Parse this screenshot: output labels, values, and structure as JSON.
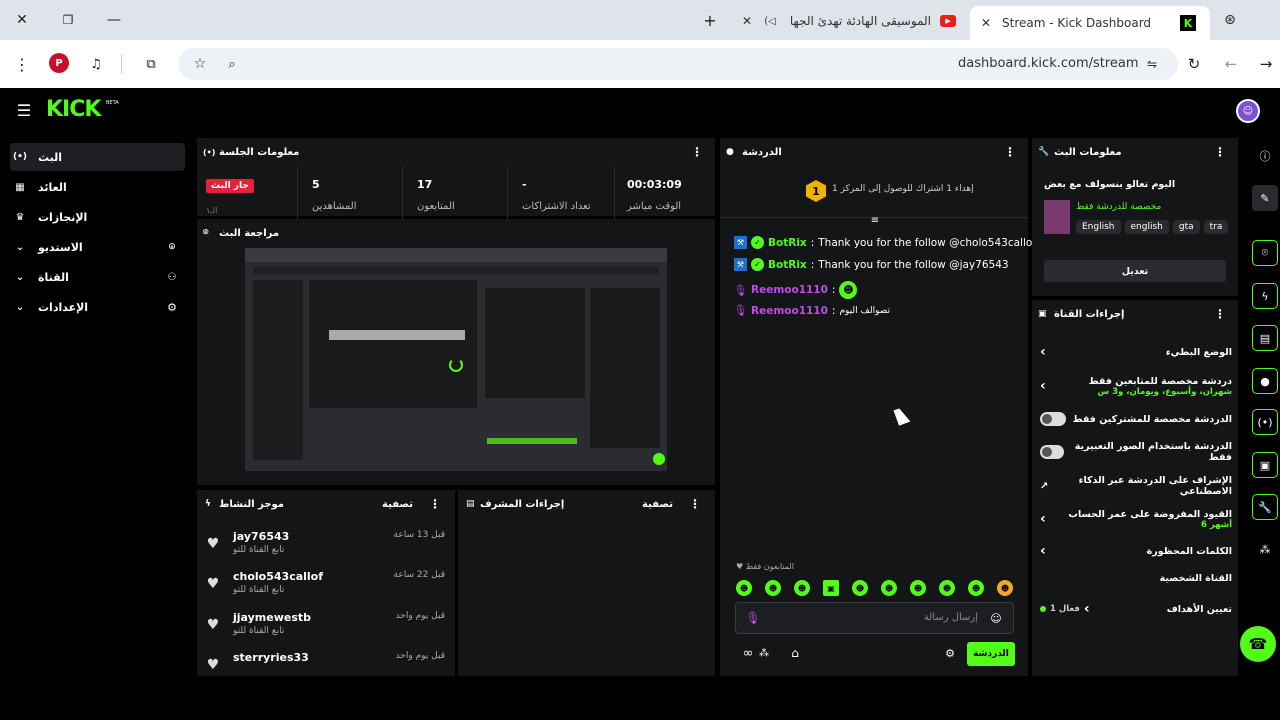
{
  "browser": {
    "tabs": [
      {
        "title": "Stream - Kick Dashboard",
        "active": true
      },
      {
        "title": "الموسيقى الهادئة تهدئ الجها",
        "active": false
      }
    ],
    "url": "dashboard.kick.com/stream",
    "profile_letter": "P"
  },
  "app": {
    "logo": "KICK",
    "logo_badge": "BETA"
  },
  "nav": {
    "items": [
      {
        "label": "البث"
      },
      {
        "label": "العائد"
      },
      {
        "label": "الإنجازات"
      },
      {
        "label": "الاستديو"
      },
      {
        "label": "القناة"
      },
      {
        "label": "الإعدادات"
      }
    ]
  },
  "session": {
    "title": "معلومات الجلسة",
    "live_badge": "جار البث",
    "live_sub": "الـ۱",
    "stats": [
      {
        "value": "5",
        "label": "المشاهدين"
      },
      {
        "value": "17",
        "label": "المتابعون"
      },
      {
        "value": "-",
        "label": "تعداد الاشتراكات"
      },
      {
        "value": "00:03:09",
        "label": "الوقت مباشر"
      }
    ]
  },
  "preview": {
    "title": "مراجعة البث"
  },
  "activity": {
    "title": "موجز النشاط",
    "filter": "تصفية",
    "items": [
      {
        "name": "jay76543",
        "sub": "تابع القناة للتو",
        "time": "قبل 13 ساعة"
      },
      {
        "name": "cholo543callof",
        "sub": "تابع القناة للتو",
        "time": "قبل 22 ساعة"
      },
      {
        "name": "jjaymewestb",
        "sub": "تابع القناة للتو",
        "time": "قبل يوم واحد"
      },
      {
        "name": "sterryries33",
        "sub": "",
        "time": "قبل يوم واحد"
      }
    ]
  },
  "mod": {
    "title": "إجراءات المشرف",
    "filter": "تصفية"
  },
  "chat": {
    "title": "الدردشة",
    "goal_text": "إهداء 1 اشتراك للوصول إلى المركز 1",
    "goal_rank": "1",
    "messages": [
      {
        "user": "BotRix",
        "text": "Thank you for the follow @cholo543callof"
      },
      {
        "user": "BotRix",
        "text": "Thank you for the follow @jay76543"
      },
      {
        "user": "Reemoo1110",
        "text": ""
      },
      {
        "user": "Reemoo1110",
        "text": "تصوالف اليوم"
      }
    ],
    "followers_only": "المتابعون فقط",
    "input_placeholder": "إرسال رسالة",
    "send_label": "الدردشة"
  },
  "stream_info": {
    "title": "معلومات البث",
    "stream_title": "اليوم تعالو بنسولف مع بعض",
    "category": "مخصصة للدردشة فقط",
    "tags": [
      "English",
      "english",
      "gta",
      "tra"
    ],
    "edit_label": "تعديل"
  },
  "channel_actions": {
    "title": "إجراءات القناة",
    "rows": [
      {
        "label": "الوضع البطيء",
        "sub": "",
        "control": "chevron"
      },
      {
        "label": "دردشة مخصصة للمتابعين فقط",
        "sub": "شهران، وأسبوع، ويومان، و3 س",
        "control": "chevron"
      },
      {
        "label": "الدردشة مخصصة للمشتركين فقط",
        "sub": "",
        "control": "toggle"
      },
      {
        "label": "الدردشة باستخدام الصور التعبيرية فقط",
        "sub": "",
        "control": "toggle"
      },
      {
        "label": "الإشراف على الدردشة عبر الذكاء الاصطناعي",
        "sub": "",
        "control": "link"
      },
      {
        "label": "القيود المفروضة على عمر الحساب",
        "sub": "أشهر 6",
        "control": "chevron"
      },
      {
        "label": "الكلمات المحظورة",
        "sub": "",
        "control": "chevron"
      }
    ],
    "section_label": "القناة الشخصية",
    "goals_label": "تعيين الأهداف",
    "goals_status": "فعال 1"
  },
  "colors": {
    "accent": "#53fc18",
    "live": "#e0243a",
    "panel": "#141517"
  }
}
